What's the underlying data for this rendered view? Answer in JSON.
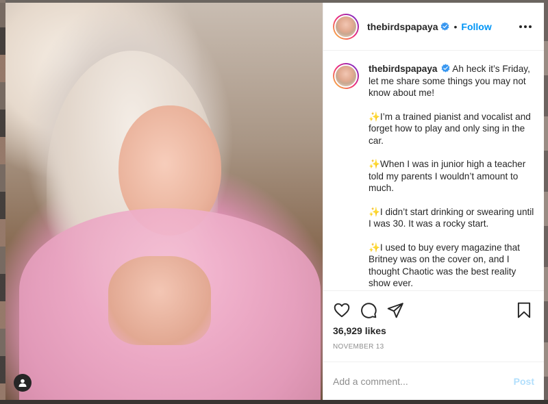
{
  "post": {
    "username": "thebirdspapaya",
    "follow_label": "Follow",
    "separator": "•",
    "caption": {
      "intro": "Ah heck it’s Friday, let me share some things you may not know about me!",
      "items": [
        "✨I’m a trained pianist and vocalist and forget how to play and only sing in the car.",
        "✨When I was in junior high a teacher told my parents I wouldn’t amount to much.",
        "✨I didn’t start drinking or swearing until I was 30. It was a rocky start.",
        "✨I used to buy every magazine that Britney was on the cover on, and I thought Chaotic was the best reality show ever."
      ]
    },
    "likes": "36,929 likes",
    "date": "November 13",
    "comment": {
      "placeholder": "Add a comment...",
      "post_label": "Post"
    }
  },
  "colors": {
    "accent": "#0095f6",
    "post_disabled": "#b2dffc",
    "text": "#262626",
    "muted": "#8e8e8e",
    "border": "#efefef"
  },
  "icons": {
    "header": [
      "verified-badge-icon",
      "more-options-icon"
    ],
    "actions": [
      "heart-icon",
      "comment-icon",
      "share-icon",
      "bookmark-icon"
    ],
    "photo": [
      "user-tag-icon"
    ]
  }
}
